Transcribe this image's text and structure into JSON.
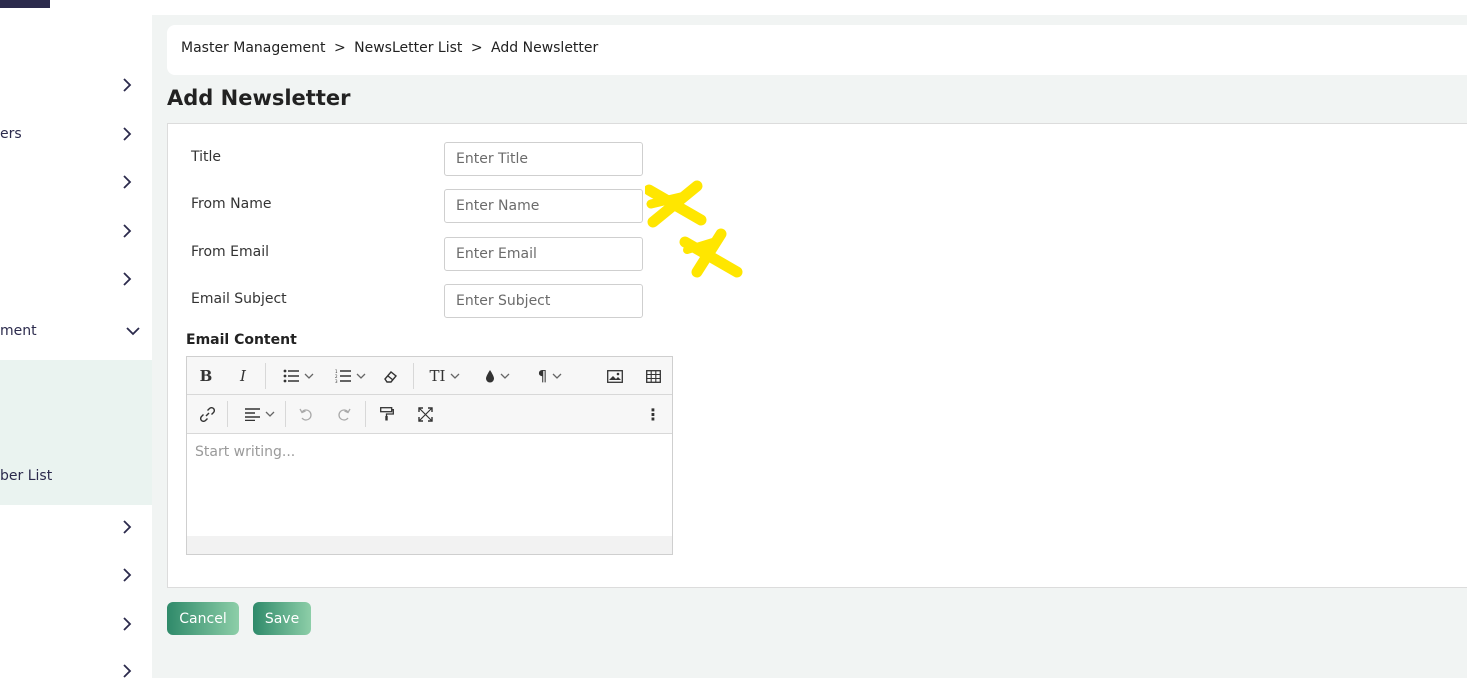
{
  "sidebar": {
    "items": [
      {
        "label": "",
        "chevron": "right"
      },
      {
        "label": "ers",
        "chevron": "right"
      },
      {
        "label": "",
        "chevron": "right"
      },
      {
        "label": "",
        "chevron": "right"
      },
      {
        "label": "",
        "chevron": "right"
      },
      {
        "label": "ment",
        "chevron": "down"
      },
      {
        "label": "ber List",
        "chevron": "none"
      },
      {
        "label": "",
        "chevron": "right"
      },
      {
        "label": "",
        "chevron": "right"
      },
      {
        "label": "",
        "chevron": "right"
      },
      {
        "label": "",
        "chevron": "right"
      }
    ]
  },
  "breadcrumb": {
    "items": [
      "Master Management",
      "NewsLetter List",
      "Add Newsletter"
    ],
    "separator": ">"
  },
  "page": {
    "title": "Add Newsletter"
  },
  "form": {
    "title": {
      "label": "Title",
      "placeholder": "Enter Title"
    },
    "from_name": {
      "label": "From Name",
      "placeholder": "Enter Name"
    },
    "from_email": {
      "label": "From Email",
      "placeholder": "Enter Email"
    },
    "email_subject": {
      "label": "Email Subject",
      "placeholder": "Enter Subject"
    },
    "email_content": {
      "label": "Email Content",
      "placeholder": "Start writing..."
    }
  },
  "editor_toolbar": {
    "bold": "B",
    "italic": "I",
    "font_size": "TI",
    "paragraph": "¶",
    "more": "⋮"
  },
  "actions": {
    "cancel_label": "Cancel",
    "save_label": "Save"
  },
  "colors": {
    "accent_start": "#2f8a6a",
    "accent_end": "#8dcea8",
    "sidebar_text": "#2b2a4c",
    "highlight_marks": "#ffe600"
  }
}
